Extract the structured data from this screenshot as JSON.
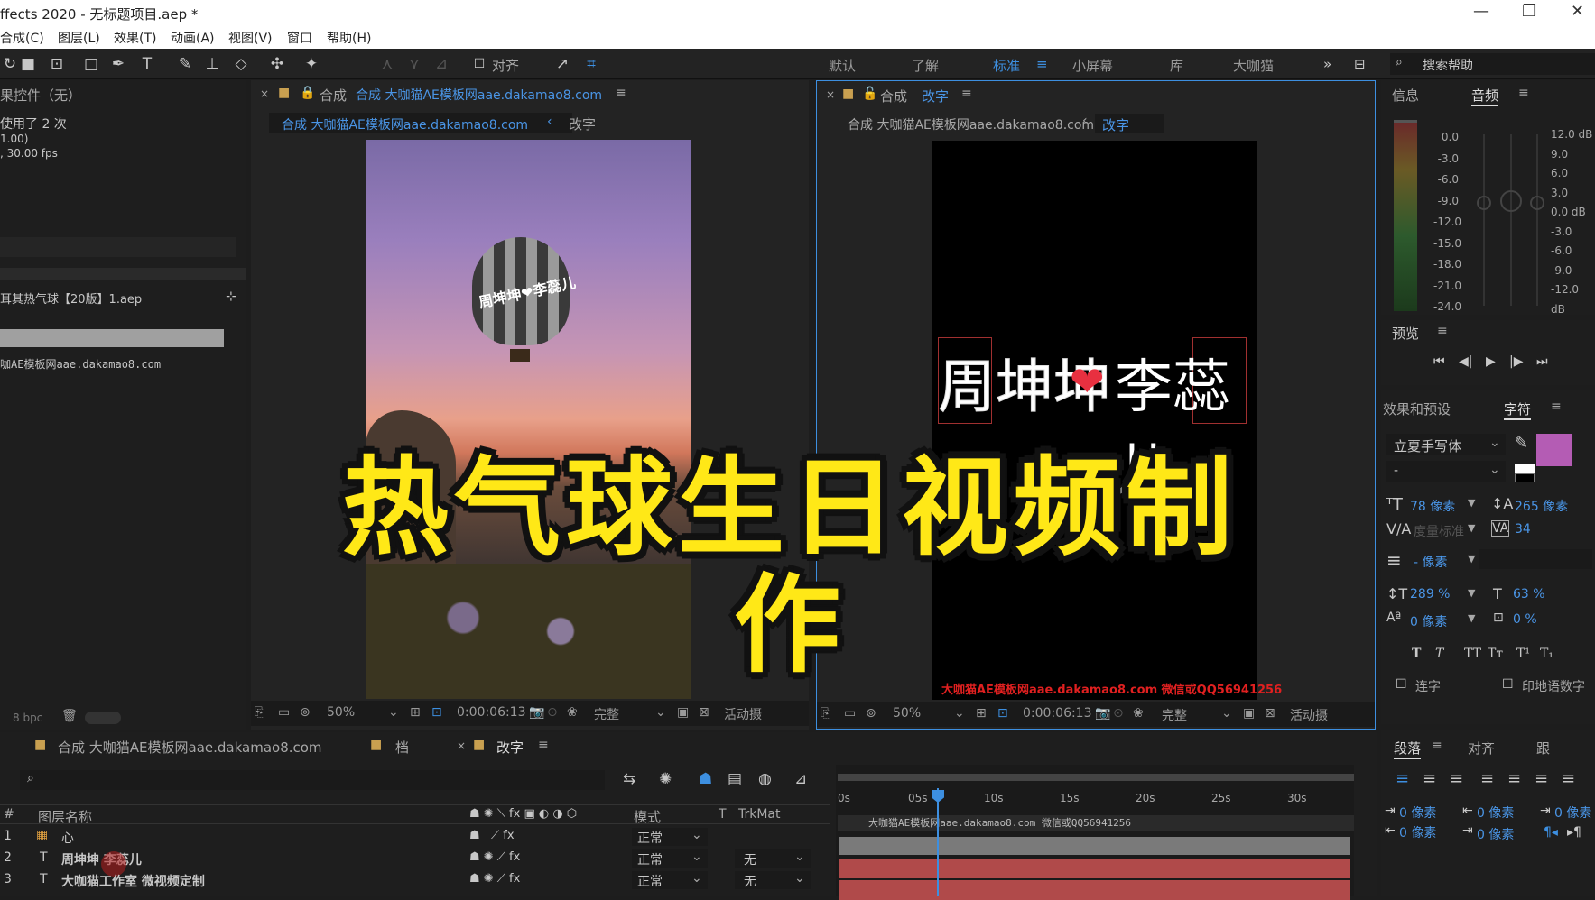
{
  "window": {
    "title": "ffects 2020 - 无标题项目.aep *"
  },
  "menu": [
    "合成(C)",
    "图层(L)",
    "效果(T)",
    "动画(A)",
    "视图(V)",
    "窗口",
    "帮助(H)"
  ],
  "toolbar": {
    "align_label": "对齐",
    "workspaces": [
      "默认",
      "了解",
      "标准",
      "小屏幕",
      "库",
      "大咖猫"
    ],
    "active_workspace": "标准",
    "more": "»",
    "search_placeholder": "搜索帮助"
  },
  "project_panel": {
    "effects_title": "果控件（无）",
    "used": "使用了 2 次",
    "duration": "1.00)",
    "fps": ", 30.00 fps",
    "item1": "耳其热气球【20版】1.aep",
    "item2": "咖AE模板网aae.dakamao8.com",
    "bpc": "8 bpc"
  },
  "comp1": {
    "tab_prefix": "合成",
    "tab_name": "合成 大咖猫AE模板网aae.dakamao8.com",
    "breadcrumb_active": "合成 大咖猫AE模板网aae.dakamao8.com",
    "breadcrumb_next": "改字",
    "balloon_text": "周坤坤❤李蕊儿",
    "zoom": "50%",
    "timecode": "0:00:06:13",
    "quality": "完整",
    "camera": "活动摄"
  },
  "comp2": {
    "tab_prefix": "合成",
    "tab_name": "改字",
    "breadcrumb_parent": "合成 大咖猫AE模板网aae.dakamao8.com",
    "breadcrumb_active": "改字",
    "left_name": "周坤坤",
    "right_name": "李蕊儿",
    "watermark": "大咖猫AE模板网aae.dakamao8.com 微信或QQ56941256",
    "zoom": "50%",
    "timecode": "0:00:06:13",
    "quality": "完整",
    "camera": "活动摄"
  },
  "overlay_title": "热气球生日视频制作",
  "right_panel": {
    "info_tab": "信息",
    "audio_tab": "音频",
    "meter_left": [
      "0.0",
      "-3.0",
      "-6.0",
      "-9.0",
      "-12.0",
      "-15.0",
      "-18.0",
      "-21.0",
      "-24.0"
    ],
    "meter_right": [
      "12.0 dB",
      "9.0",
      "6.0",
      "3.0",
      "0.0 dB",
      "-3.0",
      "-6.0",
      "-9.0",
      "-12.0 dB"
    ],
    "preview_title": "预览",
    "effects_presets": "效果和预设",
    "char_tab": "字符",
    "font_name": "立夏手写体",
    "font_style": "-",
    "size": "78 像素",
    "leading": "265 像素",
    "kerning": "度量标准",
    "tracking": "34",
    "stroke": "- 像素",
    "vscale": "289 %",
    "hscale": "63 %",
    "baseline": "0 像素",
    "tsume": "0 %",
    "ligature": "连字",
    "hindi": "印地语数字",
    "para_tab": "段落",
    "align_tab": "对齐",
    "track_tab": "跟",
    "indent1": "0 像素",
    "indent2": "0 像素",
    "indent3": "0 像素",
    "indent4": "0 像素",
    "indent5": "0 像素",
    "indent6": "0 像素",
    "swatch_color": "#b45cb4"
  },
  "timeline": {
    "tabs": [
      "合成 大咖猫AE模板网aae.dakamao8.com",
      "档",
      "改字"
    ],
    "col_hash": "#",
    "col_name": "图层名称",
    "col_mode": "模式",
    "col_t": "T",
    "col_trkmat": "TrkMat",
    "ruler": [
      "0s",
      "05s",
      "10s",
      "15s",
      "20s",
      "25s",
      "30s"
    ],
    "layers": [
      {
        "num": "1",
        "type": "img",
        "name": "心",
        "mode": "正常",
        "trk": ""
      },
      {
        "num": "2",
        "type": "T",
        "name": "周坤坤 李蕊儿",
        "mode": "正常",
        "trk": "无"
      },
      {
        "num": "3",
        "type": "T",
        "name": "大咖猫工作室 微视频定制",
        "mode": "正常",
        "trk": "无"
      }
    ],
    "bar1_label": "大咖猫AE模板网aae.dakamao8.com 微信或QQ56941256"
  }
}
